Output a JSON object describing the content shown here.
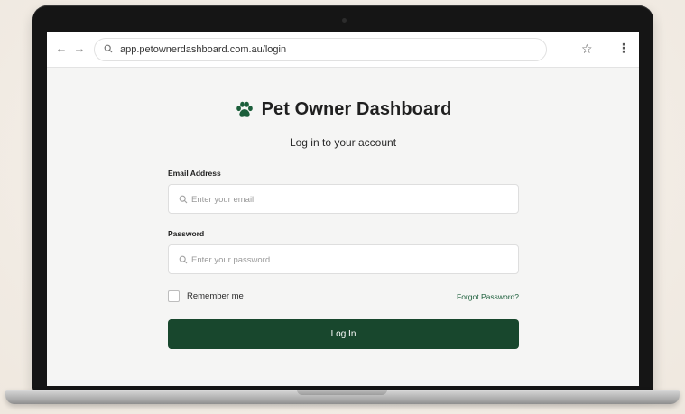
{
  "browser": {
    "back_icon": "←",
    "forward_icon": "→",
    "url": "app.petownerdashboard.com.au/login",
    "bookmark_icon": "☆",
    "menu_icon": "⋮"
  },
  "login": {
    "brand_title": "Pet Owner Dashboard",
    "subtitle": "Log in to your account",
    "email_label": "Email Address",
    "email_placeholder": "Enter your email",
    "password_label": "Password",
    "password_placeholder": "Enter your password",
    "remember_label": "Remember me",
    "forgot_label": "Forgot Password?",
    "login_label": "Log In"
  },
  "colors": {
    "brand_green": "#1b5e3a",
    "button_green": "#18472d"
  }
}
